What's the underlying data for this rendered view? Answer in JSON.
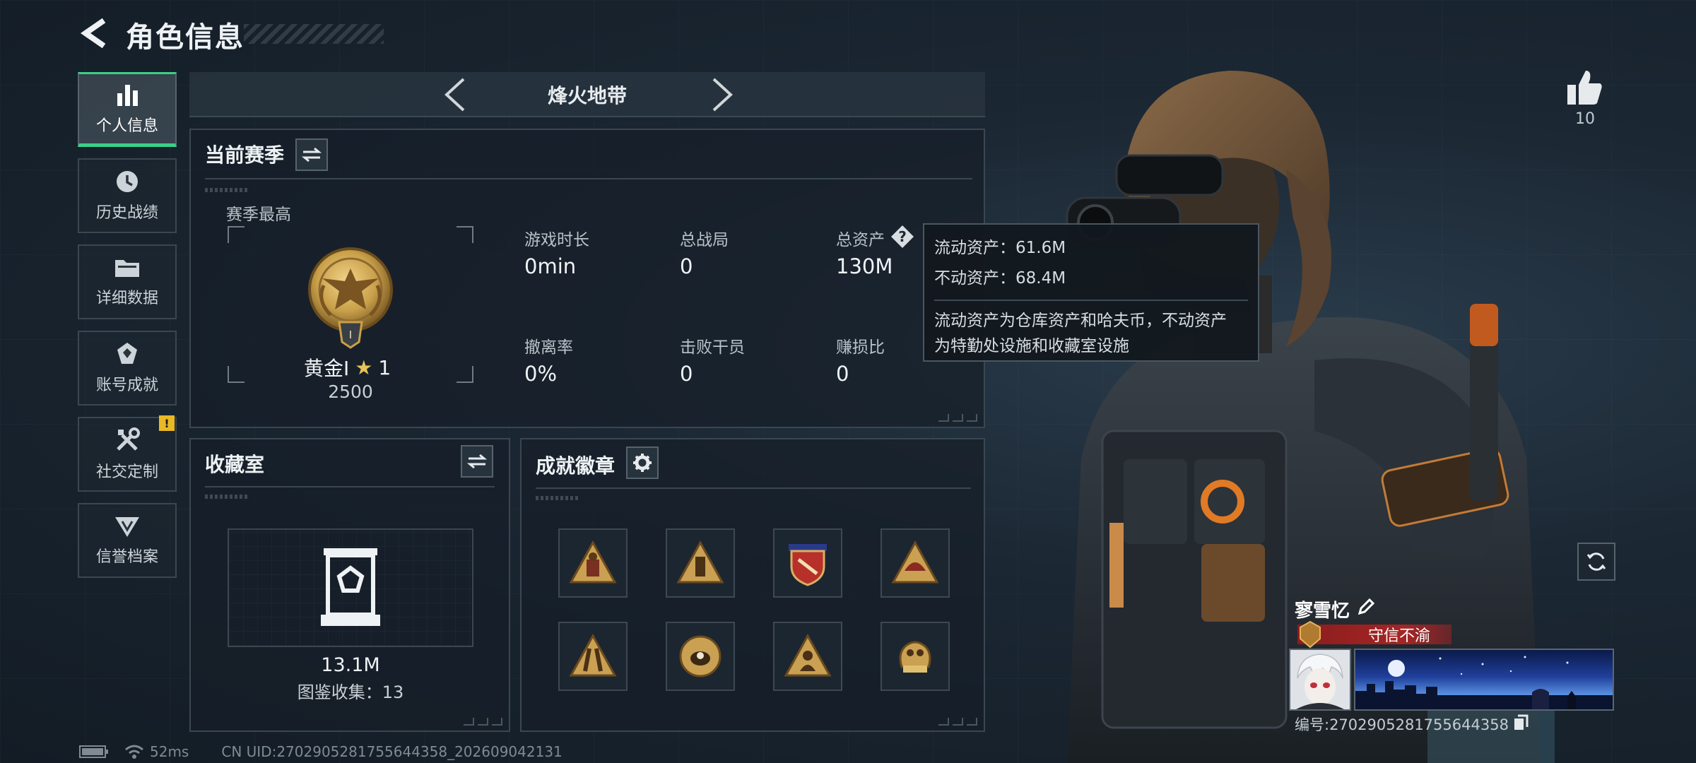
{
  "header": {
    "title": "角色信息"
  },
  "sidebar": {
    "items": [
      {
        "label": "个人信息",
        "icon": "bar-chart-icon",
        "active": true
      },
      {
        "label": "历史战绩",
        "icon": "clock-icon",
        "active": false
      },
      {
        "label": "详细数据",
        "icon": "folder-icon",
        "active": false
      },
      {
        "label": "账号成就",
        "icon": "achievement-icon",
        "active": false
      },
      {
        "label": "社交定制",
        "icon": "tools-icon",
        "active": false,
        "badge": "!"
      },
      {
        "label": "信誉档案",
        "icon": "credibility-icon",
        "active": false
      }
    ]
  },
  "mode": {
    "label": "烽火地带"
  },
  "season": {
    "title": "当前赛季",
    "best_label": "赛季最高",
    "rank_name": "黄金I",
    "rank_stars": "1",
    "rank_points": "2500",
    "rank_emblem_numeral": "I",
    "stats": [
      {
        "label": "游戏时长",
        "value": "0min"
      },
      {
        "label": "总战局",
        "value": "0"
      },
      {
        "label": "总资产",
        "value": "130M",
        "has_help": true
      },
      {
        "label": "撤离率",
        "value": "0%"
      },
      {
        "label": "击败干员",
        "value": "0"
      },
      {
        "label": "赚损比",
        "value": "0"
      }
    ]
  },
  "tooltip": {
    "line1": "流动资产：61.6M",
    "line2": "不动资产：68.4M",
    "desc1": "流动资产为仓库资产和哈夫币，不动资产",
    "desc2": "为特勤处设施和收藏室设施"
  },
  "collection": {
    "title": "收藏室",
    "value": "13.1M",
    "catalog": "图鉴收集：13"
  },
  "achievements": {
    "title": "成就徽章",
    "badges": [
      "badge-1",
      "badge-2",
      "badge-3",
      "badge-4",
      "badge-5",
      "badge-6",
      "badge-7",
      "badge-8"
    ]
  },
  "profile": {
    "likes": "10",
    "name": "寥雪忆",
    "title_tag": "守信不渝",
    "uid_line": "编号:2702905281755644358"
  },
  "status": {
    "ping": "52ms",
    "uid": "CN UID:2702905281755644358_202609042131"
  },
  "colors": {
    "accent_green": "#39d08a",
    "warning_yellow": "#e9b824",
    "title_red": "#a52525",
    "gold": "#c9a04a"
  }
}
